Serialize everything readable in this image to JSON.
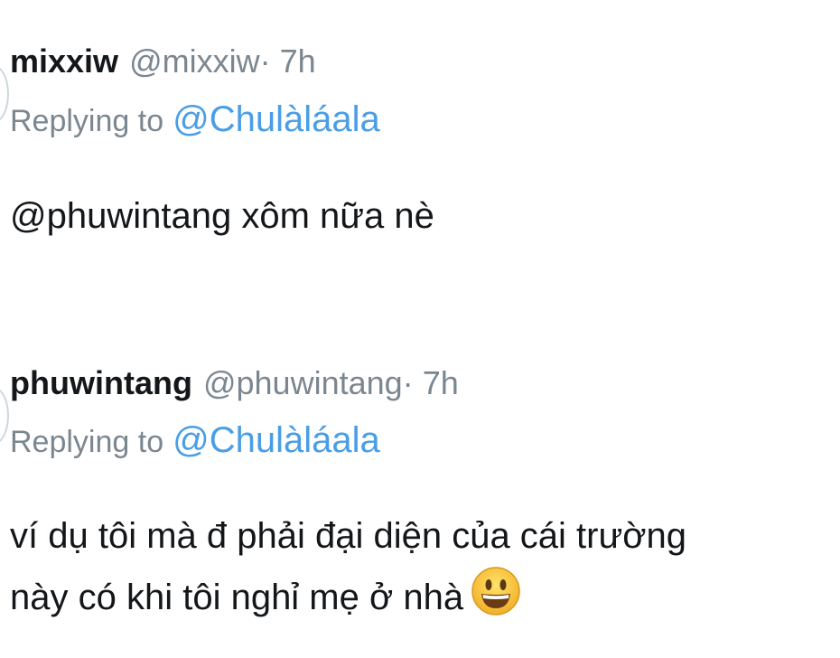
{
  "tweets": [
    {
      "display_name": "mixxiw",
      "handle": "@mixxiw",
      "separator": "·",
      "time": "7h",
      "replying_label": "Replying to",
      "replying_to": "@Chulàláala",
      "text": "@phuwintang xôm nữa nè"
    },
    {
      "display_name": "phuwintang",
      "handle": "@phuwintang",
      "separator": "·",
      "time": "7h",
      "replying_label": "Replying to",
      "replying_to": "@Chulàláala",
      "text_line1": "ví dụ tôi mà đ phải đại diện của cái trường",
      "text_line2": "này có khi tôi nghỉ mẹ ở nhà",
      "emoji": "grinning-face-emoji"
    }
  ],
  "colors": {
    "name": "#14171a",
    "muted": "#7b8790",
    "link": "#4a9ee6",
    "emoji_face": "#f7c531"
  }
}
